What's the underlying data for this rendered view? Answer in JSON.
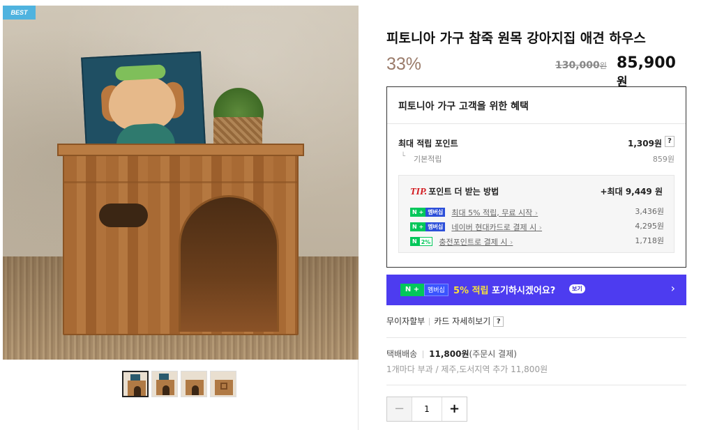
{
  "badge": "BEST",
  "product": {
    "title": "피토니아 가구 참죽 원목 강아지집 애견 하우스",
    "discount": "33%",
    "original_price": "130,000",
    "original_unit": "원",
    "sale_price": "85,900",
    "sale_unit": "원"
  },
  "benefits": {
    "title": "피토니아 가구 고객을 위한 혜택",
    "max_points_label": "최대 적립 포인트",
    "max_points_value": "1,309원",
    "base_label": "기본적립",
    "base_value": "859원",
    "tip": {
      "mark": "TIP.",
      "heading": "포인트 더 받는 방법",
      "max": "+최대 9,449 원",
      "rows": [
        {
          "badge1": "N +",
          "badge2": "멤버십",
          "link": "최대 5% 적립, 무료 시작",
          "value": "3,436원"
        },
        {
          "badge1": "N +",
          "badge2": "멤버십",
          "link": "네이버 현대카드로 결제 시",
          "value": "4,295원"
        },
        {
          "badge1": "N",
          "badge2": "2%",
          "link": "충전포인트로 결제 시",
          "value": "1,718원"
        }
      ]
    }
  },
  "banner": {
    "n_label": "N +",
    "membership": "멤버십",
    "highlight": "5% 적립",
    "text": " 포기하시겠어요?",
    "view": "보기"
  },
  "card": {
    "installment": "무이자할부",
    "details": "카드 자세히보기"
  },
  "shipping": {
    "label": "택배배송",
    "fee": "11,800원",
    "note": "(주문시 결제)",
    "sub": "1개마다 부과 / 제주,도서지역 추가 11,800원"
  },
  "quantity": "1",
  "icons": {
    "help": "?",
    "minus": "−",
    "plus": "+",
    "arrow": "›"
  }
}
